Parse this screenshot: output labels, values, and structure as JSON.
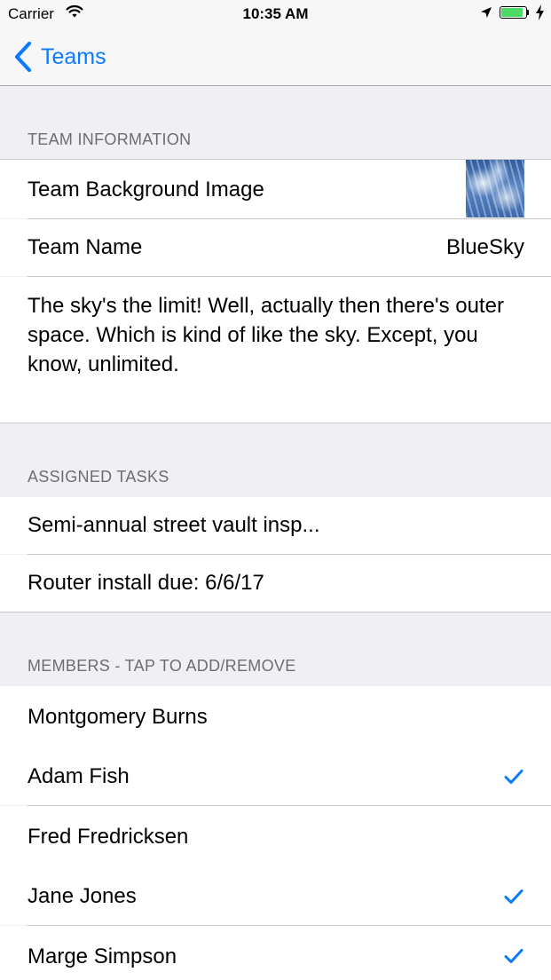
{
  "status_bar": {
    "carrier": "Carrier",
    "time": "10:35 AM",
    "battery_level_percent": 90
  },
  "nav": {
    "back_label": "Teams"
  },
  "team_info": {
    "header": "TEAM INFORMATION",
    "background_label": "Team Background Image",
    "name_label": "Team Name",
    "name_value": "BlueSky",
    "description": "The sky's the limit!  Well, actually then there's outer space.  Which is kind of like the sky.  Except, you know, unlimited."
  },
  "tasks": {
    "header": "ASSIGNED TASKS",
    "items": [
      "Semi-annual street vault insp...",
      "Router install  due: 6/6/17"
    ]
  },
  "members": {
    "header": "MEMBERS - TAP TO ADD/REMOVE",
    "items": [
      {
        "name": "Montgomery Burns",
        "selected": false
      },
      {
        "name": "Adam Fish",
        "selected": true
      },
      {
        "name": "Fred Fredricksen",
        "selected": false
      },
      {
        "name": "Jane Jones",
        "selected": true
      },
      {
        "name": "Marge Simpson",
        "selected": true
      }
    ]
  },
  "colors": {
    "accent": "#0a7aff",
    "background": "#efeff4",
    "section_header_text": "#6d6d72",
    "separator": "#c8c7cc",
    "battery": "#4cd964"
  }
}
